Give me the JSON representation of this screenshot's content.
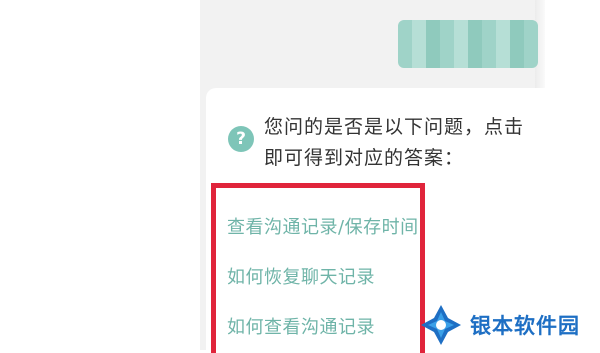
{
  "chat": {
    "prompt_line1": "您问的是否是以下问题，点击",
    "prompt_line2": "即可得到对应的答案：",
    "question_icon": "?",
    "options": [
      "查看沟通记录/保存时间",
      "如何恢复聊天记录",
      "如何查看沟通记录"
    ]
  },
  "annotation": {
    "highlight_color": "#e0243b"
  },
  "watermark": {
    "text": "银本软件园",
    "color": "#1e6fc4"
  },
  "colors": {
    "accent": "#7ec5b8",
    "link": "#6fb4a8"
  }
}
